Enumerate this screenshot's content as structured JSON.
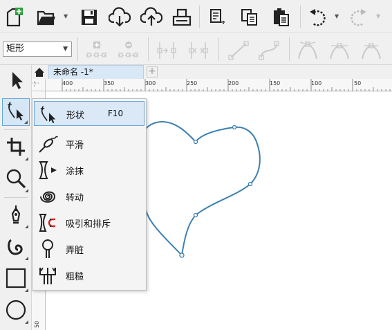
{
  "toolbar": {
    "icons": [
      "new-document-icon",
      "open-folder-icon",
      "save-icon",
      "cloud-download-icon",
      "cloud-upload-icon",
      "print-icon",
      "cut-icon",
      "copy-icon",
      "paste-icon",
      "undo-icon",
      "redo-icon"
    ]
  },
  "property_bar": {
    "shape_type": "矩形"
  },
  "tabs": {
    "document": "未命名 -1*",
    "add": "+"
  },
  "ruler": {
    "top_labels": [
      "400",
      "350",
      "300",
      "250",
      "200",
      "150",
      "100",
      "50"
    ],
    "left_labels": [
      "50"
    ]
  },
  "flyout": {
    "items": [
      {
        "label": "形状",
        "shortcut": "F10",
        "icon": "shape-tool-icon",
        "selected": true
      },
      {
        "label": "平滑",
        "icon": "smooth-tool-icon"
      },
      {
        "label": "涂抹",
        "icon": "smear-tool-icon"
      },
      {
        "label": "转动",
        "icon": "twirl-tool-icon"
      },
      {
        "label": "吸引和排斥",
        "icon": "attract-repel-tool-icon"
      },
      {
        "label": "弄脏",
        "icon": "smudge-tool-icon"
      },
      {
        "label": "粗糙",
        "icon": "roughen-tool-icon"
      }
    ]
  },
  "colors": {
    "accent": "#3c7fb1",
    "selection_bg": "#dbe9f7",
    "selection_border": "#6aa7d8"
  }
}
